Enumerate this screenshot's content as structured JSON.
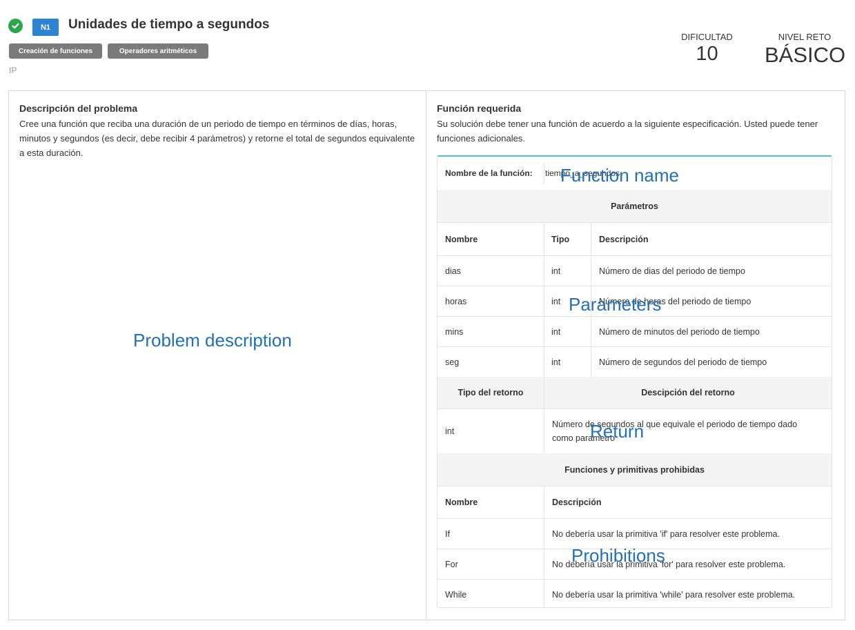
{
  "header": {
    "level_badge": "N1",
    "title": "Unidades de tiempo a segundos",
    "tags": [
      "Creación de funciones",
      "Operadores aritméticos"
    ],
    "course": "IP",
    "difficulty_label": "DIFICULTAD",
    "difficulty_value": "10",
    "challenge_label": "NIVEL RETO",
    "challenge_value": "BÁSICO"
  },
  "description": {
    "title": "Descripción del problema",
    "text": "Cree una función que reciba una duración de un periodo de tiempo en términos de días, horas, minutos y segundos (es decir, debe recibir 4 parámetros) y retorne el total de segundos equivalente a esta duración."
  },
  "required_function": {
    "title": "Función requerida",
    "text": "Su solución debe tener una función de acuerdo a la siguiente especificación. Usted puede tener funciones adicionales.",
    "name_label": "Nombre de la función:",
    "name_value": "tiempo_a_segundos",
    "params_header": "Parámetros",
    "params_columns": [
      "Nombre",
      "Tipo",
      "Descripción"
    ],
    "params": [
      {
        "name": "dias",
        "type": "int",
        "desc": "Número de dias del periodo de tiempo"
      },
      {
        "name": "horas",
        "type": "int",
        "desc": "Número de horas del periodo de tiempo"
      },
      {
        "name": "mins",
        "type": "int",
        "desc": "Número de minutos del periodo de tiempo"
      },
      {
        "name": "seg",
        "type": "int",
        "desc": "Número de segundos del periodo de tiempo"
      }
    ],
    "return_type_header": "Tipo del retorno",
    "return_desc_header": "Descipción del retorno",
    "return_type": "int",
    "return_desc": "Número de segundos al que equivale el periodo de tiempo dado como parametro",
    "prohibited_header": "Funciones y primitivas prohibidas",
    "prohibited_columns": [
      "Nombre",
      "Descripción"
    ],
    "prohibited": [
      {
        "name": "If",
        "desc": "No debería usar la primitiva 'if' para resolver este problema."
      },
      {
        "name": "For",
        "desc": "No debería usar la primitiva 'for' para resolver este problema."
      },
      {
        "name": "While",
        "desc": "No debería usar la primitiva 'while' para resolver este problema."
      }
    ]
  },
  "overlays": {
    "problem_description": "Problem description",
    "function_name": "Function name",
    "parameters": "Parameters",
    "return": "Return",
    "prohibitions": "Prohibitions"
  },
  "colors": {
    "check": "#2aa64b",
    "badge": "#2d84d5",
    "tag": "#7a7a7a",
    "spec_top_border": "#46c6cf",
    "overlay_text": "#2470b5"
  }
}
